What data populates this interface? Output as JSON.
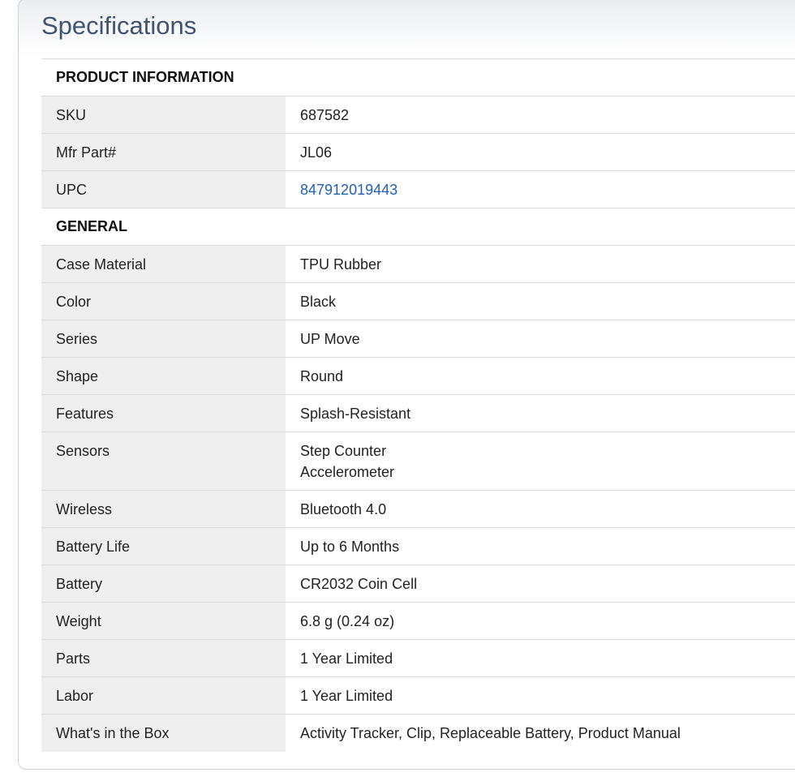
{
  "header": {
    "title": "Specifications"
  },
  "sections": [
    {
      "title": "PRODUCT INFORMATION",
      "rows": [
        {
          "label": "SKU",
          "value": "687582"
        },
        {
          "label": "Mfr Part#",
          "value": "JL06"
        },
        {
          "label": "UPC",
          "value": "847912019443"
        }
      ]
    },
    {
      "title": "GENERAL",
      "rows": [
        {
          "label": "Case Material",
          "value": "TPU Rubber"
        },
        {
          "label": "Color",
          "value": "Black"
        },
        {
          "label": "Series",
          "value": "UP Move"
        },
        {
          "label": "Shape",
          "value": "Round"
        },
        {
          "label": "Features",
          "value": "Splash-Resistant"
        },
        {
          "label": "Sensors",
          "value_lines": [
            "Step Counter",
            "Accelerometer"
          ]
        },
        {
          "label": "Wireless",
          "value": "Bluetooth 4.0"
        },
        {
          "label": "Battery Life",
          "value": "Up to 6 Months"
        },
        {
          "label": "Battery",
          "value": "CR2032 Coin Cell"
        },
        {
          "label": "Weight",
          "value": "6.8 g (0.24 oz)"
        },
        {
          "label": "Parts",
          "value": "1 Year Limited"
        },
        {
          "label": "Labor",
          "value": "1 Year Limited"
        },
        {
          "label": "What's in the Box",
          "value": "Activity Tracker, Clip, Replaceable Battery, Product Manual"
        }
      ]
    }
  ],
  "colors": {
    "title": "#3f5372",
    "label_background": "#efefef",
    "link": "#1e5fb8",
    "border": "#d9d9d9"
  }
}
